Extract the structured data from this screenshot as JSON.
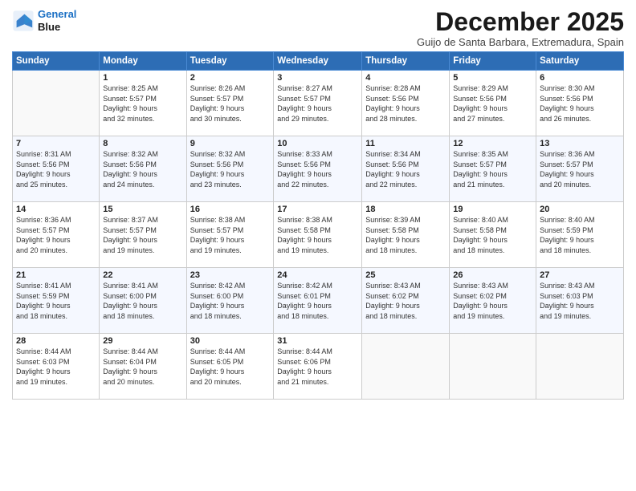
{
  "header": {
    "logo_line1": "General",
    "logo_line2": "Blue",
    "month": "December 2025",
    "location": "Guijo de Santa Barbara, Extremadura, Spain"
  },
  "weekdays": [
    "Sunday",
    "Monday",
    "Tuesday",
    "Wednesday",
    "Thursday",
    "Friday",
    "Saturday"
  ],
  "weeks": [
    [
      {
        "day": "",
        "info": ""
      },
      {
        "day": "1",
        "info": "Sunrise: 8:25 AM\nSunset: 5:57 PM\nDaylight: 9 hours\nand 32 minutes."
      },
      {
        "day": "2",
        "info": "Sunrise: 8:26 AM\nSunset: 5:57 PM\nDaylight: 9 hours\nand 30 minutes."
      },
      {
        "day": "3",
        "info": "Sunrise: 8:27 AM\nSunset: 5:57 PM\nDaylight: 9 hours\nand 29 minutes."
      },
      {
        "day": "4",
        "info": "Sunrise: 8:28 AM\nSunset: 5:56 PM\nDaylight: 9 hours\nand 28 minutes."
      },
      {
        "day": "5",
        "info": "Sunrise: 8:29 AM\nSunset: 5:56 PM\nDaylight: 9 hours\nand 27 minutes."
      },
      {
        "day": "6",
        "info": "Sunrise: 8:30 AM\nSunset: 5:56 PM\nDaylight: 9 hours\nand 26 minutes."
      }
    ],
    [
      {
        "day": "7",
        "info": "Sunrise: 8:31 AM\nSunset: 5:56 PM\nDaylight: 9 hours\nand 25 minutes."
      },
      {
        "day": "8",
        "info": "Sunrise: 8:32 AM\nSunset: 5:56 PM\nDaylight: 9 hours\nand 24 minutes."
      },
      {
        "day": "9",
        "info": "Sunrise: 8:32 AM\nSunset: 5:56 PM\nDaylight: 9 hours\nand 23 minutes."
      },
      {
        "day": "10",
        "info": "Sunrise: 8:33 AM\nSunset: 5:56 PM\nDaylight: 9 hours\nand 22 minutes."
      },
      {
        "day": "11",
        "info": "Sunrise: 8:34 AM\nSunset: 5:56 PM\nDaylight: 9 hours\nand 22 minutes."
      },
      {
        "day": "12",
        "info": "Sunrise: 8:35 AM\nSunset: 5:57 PM\nDaylight: 9 hours\nand 21 minutes."
      },
      {
        "day": "13",
        "info": "Sunrise: 8:36 AM\nSunset: 5:57 PM\nDaylight: 9 hours\nand 20 minutes."
      }
    ],
    [
      {
        "day": "14",
        "info": "Sunrise: 8:36 AM\nSunset: 5:57 PM\nDaylight: 9 hours\nand 20 minutes."
      },
      {
        "day": "15",
        "info": "Sunrise: 8:37 AM\nSunset: 5:57 PM\nDaylight: 9 hours\nand 19 minutes."
      },
      {
        "day": "16",
        "info": "Sunrise: 8:38 AM\nSunset: 5:57 PM\nDaylight: 9 hours\nand 19 minutes."
      },
      {
        "day": "17",
        "info": "Sunrise: 8:38 AM\nSunset: 5:58 PM\nDaylight: 9 hours\nand 19 minutes."
      },
      {
        "day": "18",
        "info": "Sunrise: 8:39 AM\nSunset: 5:58 PM\nDaylight: 9 hours\nand 18 minutes."
      },
      {
        "day": "19",
        "info": "Sunrise: 8:40 AM\nSunset: 5:58 PM\nDaylight: 9 hours\nand 18 minutes."
      },
      {
        "day": "20",
        "info": "Sunrise: 8:40 AM\nSunset: 5:59 PM\nDaylight: 9 hours\nand 18 minutes."
      }
    ],
    [
      {
        "day": "21",
        "info": "Sunrise: 8:41 AM\nSunset: 5:59 PM\nDaylight: 9 hours\nand 18 minutes."
      },
      {
        "day": "22",
        "info": "Sunrise: 8:41 AM\nSunset: 6:00 PM\nDaylight: 9 hours\nand 18 minutes."
      },
      {
        "day": "23",
        "info": "Sunrise: 8:42 AM\nSunset: 6:00 PM\nDaylight: 9 hours\nand 18 minutes."
      },
      {
        "day": "24",
        "info": "Sunrise: 8:42 AM\nSunset: 6:01 PM\nDaylight: 9 hours\nand 18 minutes."
      },
      {
        "day": "25",
        "info": "Sunrise: 8:43 AM\nSunset: 6:02 PM\nDaylight: 9 hours\nand 18 minutes."
      },
      {
        "day": "26",
        "info": "Sunrise: 8:43 AM\nSunset: 6:02 PM\nDaylight: 9 hours\nand 19 minutes."
      },
      {
        "day": "27",
        "info": "Sunrise: 8:43 AM\nSunset: 6:03 PM\nDaylight: 9 hours\nand 19 minutes."
      }
    ],
    [
      {
        "day": "28",
        "info": "Sunrise: 8:44 AM\nSunset: 6:03 PM\nDaylight: 9 hours\nand 19 minutes."
      },
      {
        "day": "29",
        "info": "Sunrise: 8:44 AM\nSunset: 6:04 PM\nDaylight: 9 hours\nand 20 minutes."
      },
      {
        "day": "30",
        "info": "Sunrise: 8:44 AM\nSunset: 6:05 PM\nDaylight: 9 hours\nand 20 minutes."
      },
      {
        "day": "31",
        "info": "Sunrise: 8:44 AM\nSunset: 6:06 PM\nDaylight: 9 hours\nand 21 minutes."
      },
      {
        "day": "",
        "info": ""
      },
      {
        "day": "",
        "info": ""
      },
      {
        "day": "",
        "info": ""
      }
    ]
  ]
}
